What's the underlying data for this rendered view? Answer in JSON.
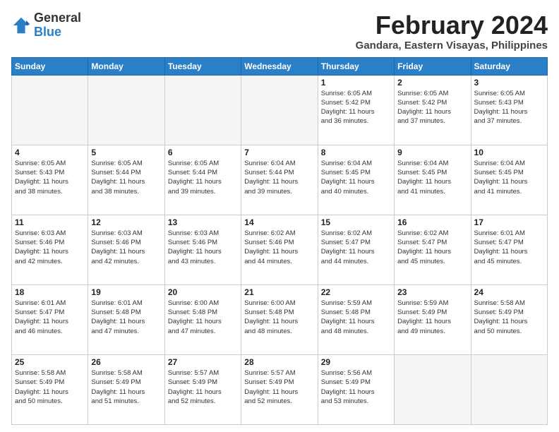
{
  "logo": {
    "general": "General",
    "blue": "Blue"
  },
  "header": {
    "title": "February 2024",
    "subtitle": "Gandara, Eastern Visayas, Philippines"
  },
  "weekdays": [
    "Sunday",
    "Monday",
    "Tuesday",
    "Wednesday",
    "Thursday",
    "Friday",
    "Saturday"
  ],
  "weeks": [
    [
      {
        "day": "",
        "info": ""
      },
      {
        "day": "",
        "info": ""
      },
      {
        "day": "",
        "info": ""
      },
      {
        "day": "",
        "info": ""
      },
      {
        "day": "1",
        "info": "Sunrise: 6:05 AM\nSunset: 5:42 PM\nDaylight: 11 hours\nand 36 minutes."
      },
      {
        "day": "2",
        "info": "Sunrise: 6:05 AM\nSunset: 5:42 PM\nDaylight: 11 hours\nand 37 minutes."
      },
      {
        "day": "3",
        "info": "Sunrise: 6:05 AM\nSunset: 5:43 PM\nDaylight: 11 hours\nand 37 minutes."
      }
    ],
    [
      {
        "day": "4",
        "info": "Sunrise: 6:05 AM\nSunset: 5:43 PM\nDaylight: 11 hours\nand 38 minutes."
      },
      {
        "day": "5",
        "info": "Sunrise: 6:05 AM\nSunset: 5:44 PM\nDaylight: 11 hours\nand 38 minutes."
      },
      {
        "day": "6",
        "info": "Sunrise: 6:05 AM\nSunset: 5:44 PM\nDaylight: 11 hours\nand 39 minutes."
      },
      {
        "day": "7",
        "info": "Sunrise: 6:04 AM\nSunset: 5:44 PM\nDaylight: 11 hours\nand 39 minutes."
      },
      {
        "day": "8",
        "info": "Sunrise: 6:04 AM\nSunset: 5:45 PM\nDaylight: 11 hours\nand 40 minutes."
      },
      {
        "day": "9",
        "info": "Sunrise: 6:04 AM\nSunset: 5:45 PM\nDaylight: 11 hours\nand 41 minutes."
      },
      {
        "day": "10",
        "info": "Sunrise: 6:04 AM\nSunset: 5:45 PM\nDaylight: 11 hours\nand 41 minutes."
      }
    ],
    [
      {
        "day": "11",
        "info": "Sunrise: 6:03 AM\nSunset: 5:46 PM\nDaylight: 11 hours\nand 42 minutes."
      },
      {
        "day": "12",
        "info": "Sunrise: 6:03 AM\nSunset: 5:46 PM\nDaylight: 11 hours\nand 42 minutes."
      },
      {
        "day": "13",
        "info": "Sunrise: 6:03 AM\nSunset: 5:46 PM\nDaylight: 11 hours\nand 43 minutes."
      },
      {
        "day": "14",
        "info": "Sunrise: 6:02 AM\nSunset: 5:46 PM\nDaylight: 11 hours\nand 44 minutes."
      },
      {
        "day": "15",
        "info": "Sunrise: 6:02 AM\nSunset: 5:47 PM\nDaylight: 11 hours\nand 44 minutes."
      },
      {
        "day": "16",
        "info": "Sunrise: 6:02 AM\nSunset: 5:47 PM\nDaylight: 11 hours\nand 45 minutes."
      },
      {
        "day": "17",
        "info": "Sunrise: 6:01 AM\nSunset: 5:47 PM\nDaylight: 11 hours\nand 45 minutes."
      }
    ],
    [
      {
        "day": "18",
        "info": "Sunrise: 6:01 AM\nSunset: 5:47 PM\nDaylight: 11 hours\nand 46 minutes."
      },
      {
        "day": "19",
        "info": "Sunrise: 6:01 AM\nSunset: 5:48 PM\nDaylight: 11 hours\nand 47 minutes."
      },
      {
        "day": "20",
        "info": "Sunrise: 6:00 AM\nSunset: 5:48 PM\nDaylight: 11 hours\nand 47 minutes."
      },
      {
        "day": "21",
        "info": "Sunrise: 6:00 AM\nSunset: 5:48 PM\nDaylight: 11 hours\nand 48 minutes."
      },
      {
        "day": "22",
        "info": "Sunrise: 5:59 AM\nSunset: 5:48 PM\nDaylight: 11 hours\nand 48 minutes."
      },
      {
        "day": "23",
        "info": "Sunrise: 5:59 AM\nSunset: 5:49 PM\nDaylight: 11 hours\nand 49 minutes."
      },
      {
        "day": "24",
        "info": "Sunrise: 5:58 AM\nSunset: 5:49 PM\nDaylight: 11 hours\nand 50 minutes."
      }
    ],
    [
      {
        "day": "25",
        "info": "Sunrise: 5:58 AM\nSunset: 5:49 PM\nDaylight: 11 hours\nand 50 minutes."
      },
      {
        "day": "26",
        "info": "Sunrise: 5:58 AM\nSunset: 5:49 PM\nDaylight: 11 hours\nand 51 minutes."
      },
      {
        "day": "27",
        "info": "Sunrise: 5:57 AM\nSunset: 5:49 PM\nDaylight: 11 hours\nand 52 minutes."
      },
      {
        "day": "28",
        "info": "Sunrise: 5:57 AM\nSunset: 5:49 PM\nDaylight: 11 hours\nand 52 minutes."
      },
      {
        "day": "29",
        "info": "Sunrise: 5:56 AM\nSunset: 5:49 PM\nDaylight: 11 hours\nand 53 minutes."
      },
      {
        "day": "",
        "info": ""
      },
      {
        "day": "",
        "info": ""
      }
    ]
  ]
}
